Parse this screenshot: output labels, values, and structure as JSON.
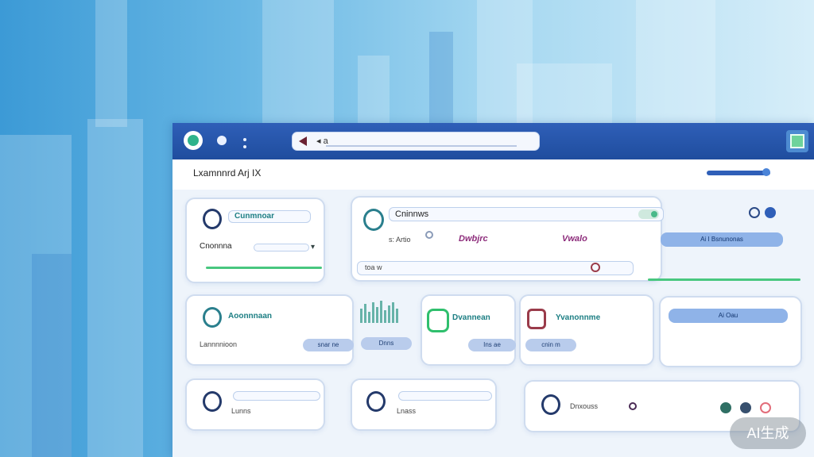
{
  "colors": {
    "titlebar": "#1f4d9e",
    "accent_green": "#48c77f",
    "accent_teal": "#1c7e83",
    "accent_pink": "#8d2c7b",
    "card_bg": "#ffffff"
  },
  "titlebar": {
    "logo_icon": "app-logo-icon",
    "address_text": "◂ a",
    "maximize_icon": "maximize-icon"
  },
  "subbar": {
    "title": "Lxamnnrd Arj IX"
  },
  "cards": {
    "profile": {
      "heading": "Cunmnoar",
      "field_label": "Cnonnna"
    },
    "overview": {
      "heading": "Cninnws",
      "meta": "s: Artio",
      "tag_left": "Dwbjrc",
      "tag_right": "Vwalo",
      "filter_label": "Ai I Bsnunonas",
      "bottom_field": "toa w"
    },
    "row2_a": {
      "heading": "Aoonnnaan",
      "sub": "Lannnnioon",
      "pill_1": "snar ne",
      "pill_2": "Dnns"
    },
    "row2_b": {
      "heading": "Dvannean",
      "pill": "Ins ae"
    },
    "row2_c": {
      "heading": "Yvanonnme",
      "pill": "cnin m"
    },
    "row2_d": {
      "label": "Ai Oau"
    },
    "row3_a": {
      "label": "Lunns"
    },
    "row3_b": {
      "label": "Lnass"
    },
    "row3_c": {
      "label": "Dnxouss"
    }
  },
  "watermark": "AI生成"
}
